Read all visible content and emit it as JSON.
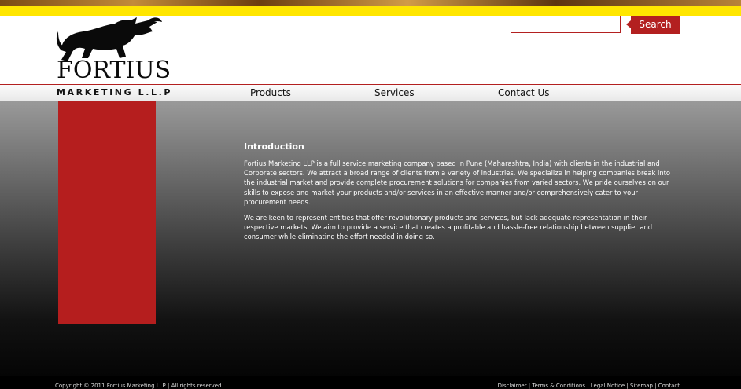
{
  "header": {
    "logo_text": "FORTIUS",
    "tagline": "MARKETING L.L.P",
    "search": {
      "placeholder": "",
      "button_label": "Search"
    }
  },
  "nav": {
    "items": [
      {
        "label": "Products"
      },
      {
        "label": "Services"
      },
      {
        "label": "Contact Us"
      }
    ]
  },
  "main": {
    "heading": "Introduction",
    "paragraphs": [
      "Fortius Marketing LLP is a full service marketing company based in Pune (Maharashtra, India) with clients in the industrial and Corporate sectors. We attract a broad range of clients from a variety of industries. We specialize in helping companies break into the industrial market and provide complete procurement solutions for companies from varied sectors. We pride ourselves on our skills to expose and market your products and/or services in an effective manner and/or comprehensively cater to your procurement needs.",
      "We are keen to represent entities that offer revolutionary products and services, but lack adequate representation in their respective markets. We aim to provide a service that creates a profitable and hassle-free relationship between supplier and consumer while eliminating the effort needed in doing so."
    ]
  },
  "footer": {
    "copyright": "Copyright © 2011 Fortius Marketing LLP | All rights reserved",
    "links": [
      "Disclaimer",
      "Terms & Conditions",
      "Legal Notice",
      "Sitemap",
      "Contact"
    ],
    "separator": " | "
  },
  "colors": {
    "accent": "#b32020",
    "highlight": "#ffe600"
  },
  "icons": {
    "logo": "bull-icon"
  }
}
